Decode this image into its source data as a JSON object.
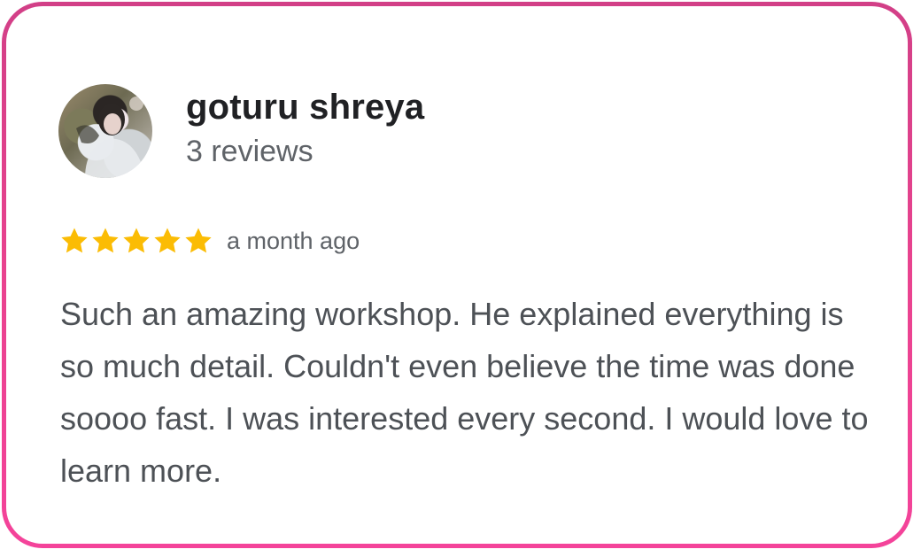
{
  "review": {
    "reviewer": {
      "name": "goturu shreya",
      "review_count": "3 reviews",
      "avatar": "profile-photo"
    },
    "rating": 5,
    "max_rating": 5,
    "star_color": "#fbbc04",
    "date": "a month ago",
    "text": "Such an amazing workshop. He explained everything is so much detail. Couldn't even believe the time was done soooo fast. I was interested every second. I would love to learn more."
  },
  "colors": {
    "border_top": "#d23f87",
    "border_bottom": "#f4439a",
    "name_color": "#202124",
    "muted_color": "#5f6368",
    "body_text_color": "#4d5156"
  }
}
